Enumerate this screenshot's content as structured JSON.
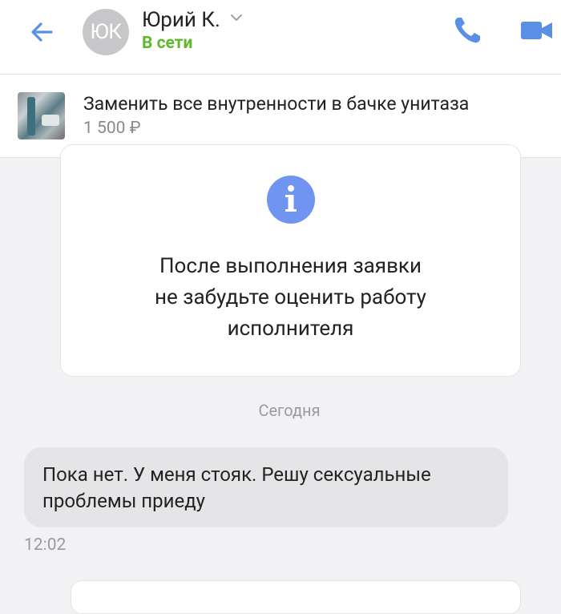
{
  "header": {
    "avatar_initials": "ЮК",
    "contact_name": "Юрий К.",
    "status": "В сети",
    "accent_color": "#5a8fe6",
    "status_color": "#5fb82f"
  },
  "order": {
    "title": "Заменить все внутренности в бачке унитаза",
    "price": "1 500 ₽"
  },
  "info_card": {
    "lines": [
      "После выполнения заявки",
      "не забудьте оценить работу",
      "исполнителя"
    ],
    "icon_color": "#6f95f0"
  },
  "chat": {
    "date_separator": "Сегодня",
    "messages": [
      {
        "lines": [
          "Пока нет. У меня стояк. Решу сексуальные",
          "проблемы приеду"
        ],
        "time": "12:02"
      }
    ]
  }
}
